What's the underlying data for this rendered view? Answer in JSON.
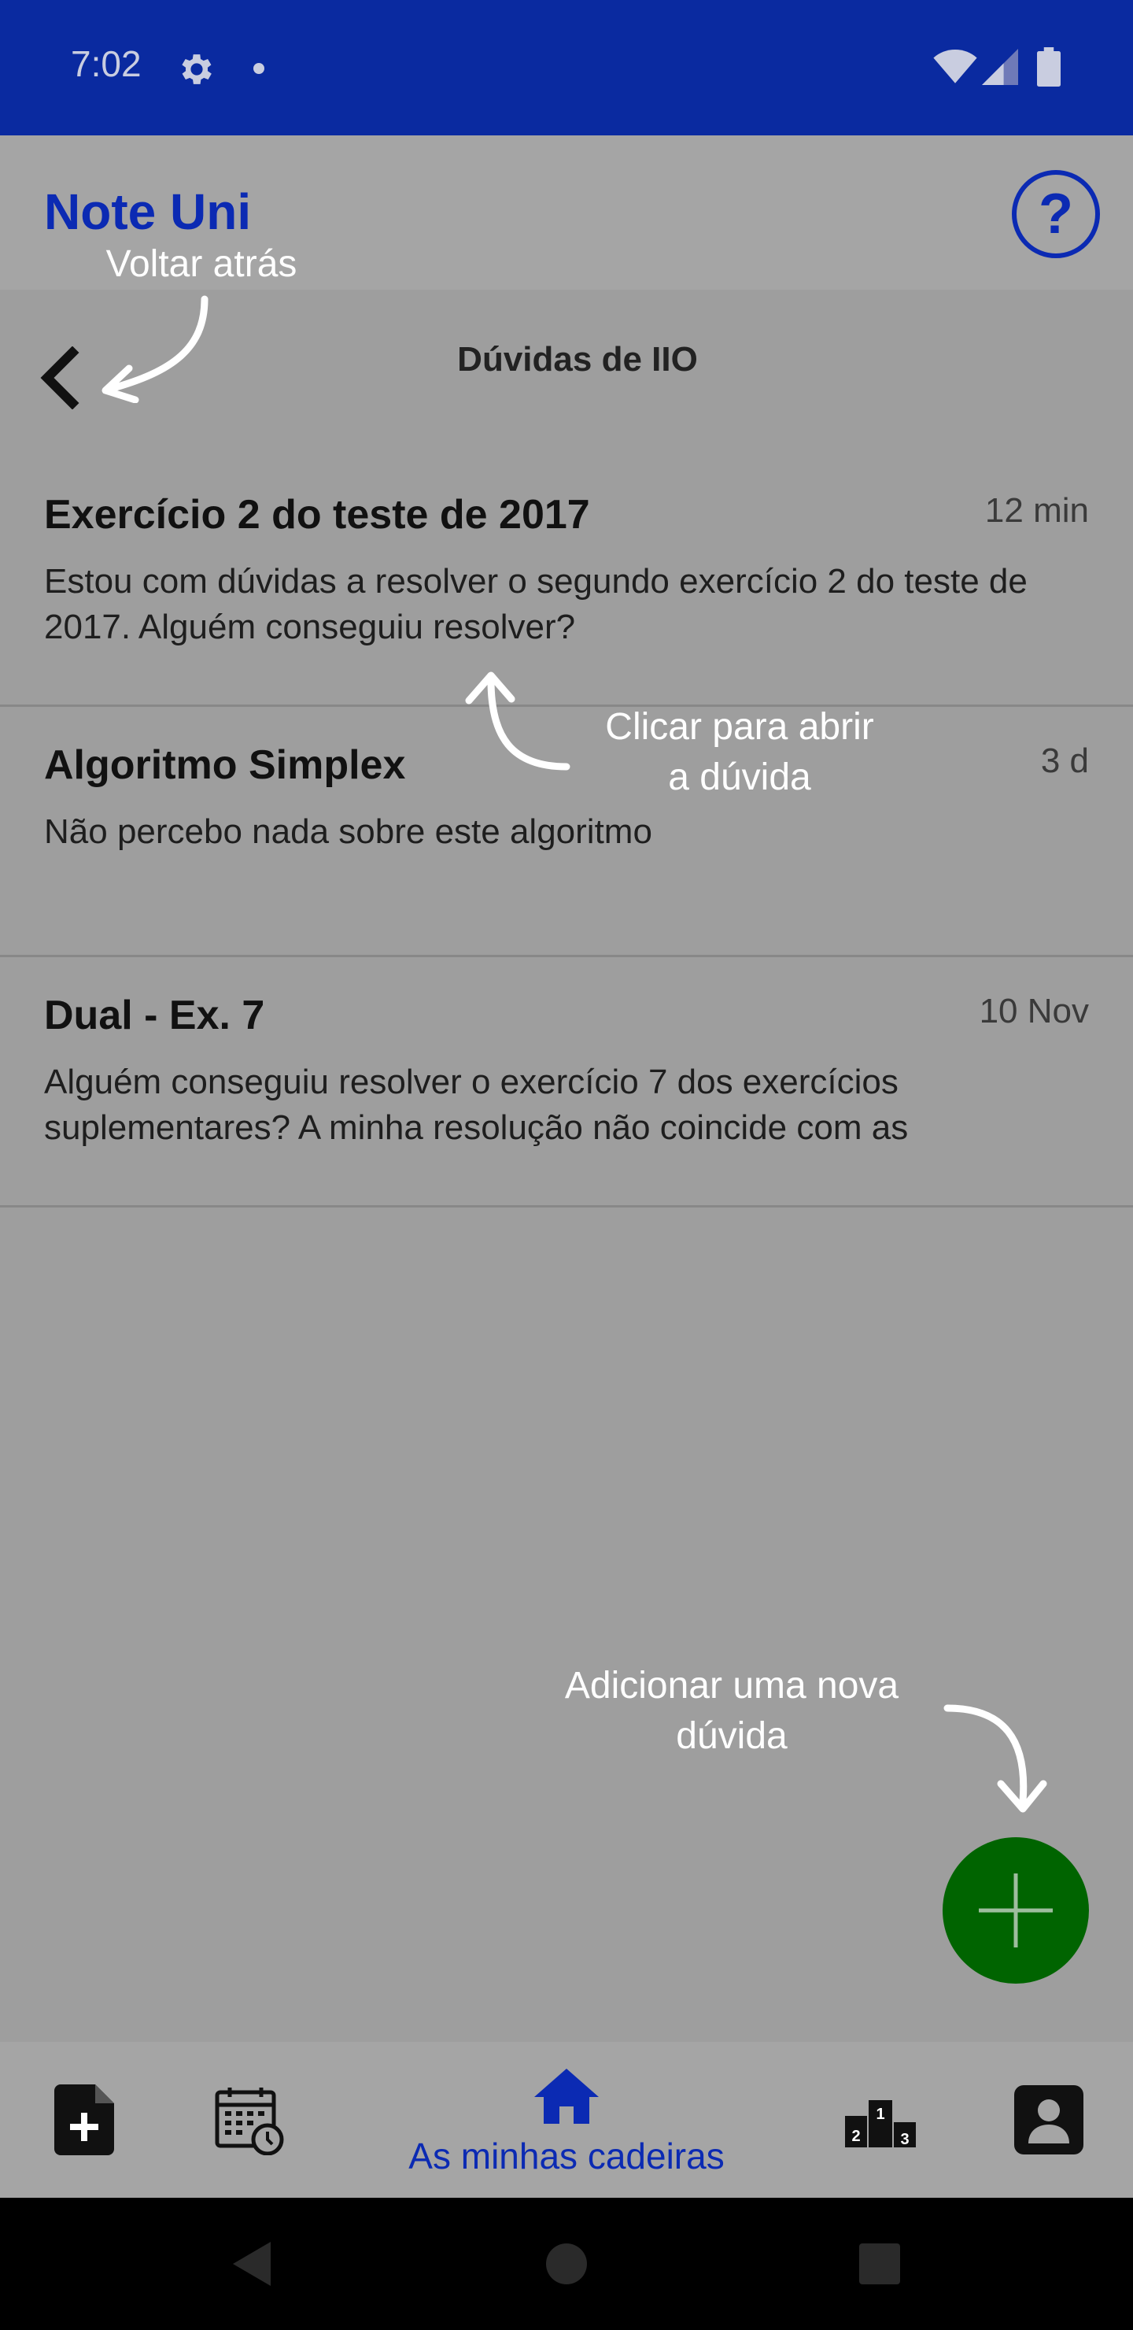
{
  "status_bar": {
    "time": "7:02",
    "icons": [
      "gear-icon",
      "notification-dot-icon",
      "wifi-icon",
      "signal-icon",
      "battery-icon"
    ],
    "color": "#0a2aa0"
  },
  "header": {
    "app_title": "Note Uni",
    "help_label": "?"
  },
  "subheader": {
    "title": "Dúvidas de IIO"
  },
  "questions": [
    {
      "title": "Exercício 2 do teste de 2017",
      "time": "12 min",
      "body": "Estou com dúvidas a resolver o segundo exercício 2 do teste de 2017. Alguém conseguiu resolver?"
    },
    {
      "title": "Algoritmo Simplex",
      "time": "3 d",
      "body": "Não percebo nada sobre este algoritmo"
    },
    {
      "title": "Dual - Ex. 7",
      "time": "10 Nov",
      "body": "Alguém conseguiu resolver o exercício 7 dos exercícios suplementares? A minha resolução não coincide com as"
    }
  ],
  "hints": {
    "back": "Voltar atrás",
    "open_line1": "Clicar para abrir",
    "open_line2": "a dúvida",
    "add_line1": "Adicionar uma nova",
    "add_line2": "dúvida"
  },
  "bottom_nav": {
    "items": [
      {
        "icon": "add-document-icon"
      },
      {
        "icon": "calendar-clock-icon"
      },
      {
        "icon": "home-icon",
        "label": "As minhas cadeiras"
      },
      {
        "icon": "podium-icon"
      },
      {
        "icon": "profile-icon"
      }
    ],
    "podium_numbers": [
      "2",
      "1",
      "3"
    ]
  },
  "colors": {
    "brand_blue": "#0b2ab3",
    "fab_green": "#006400",
    "overlay_gray": "#9e9e9e"
  }
}
